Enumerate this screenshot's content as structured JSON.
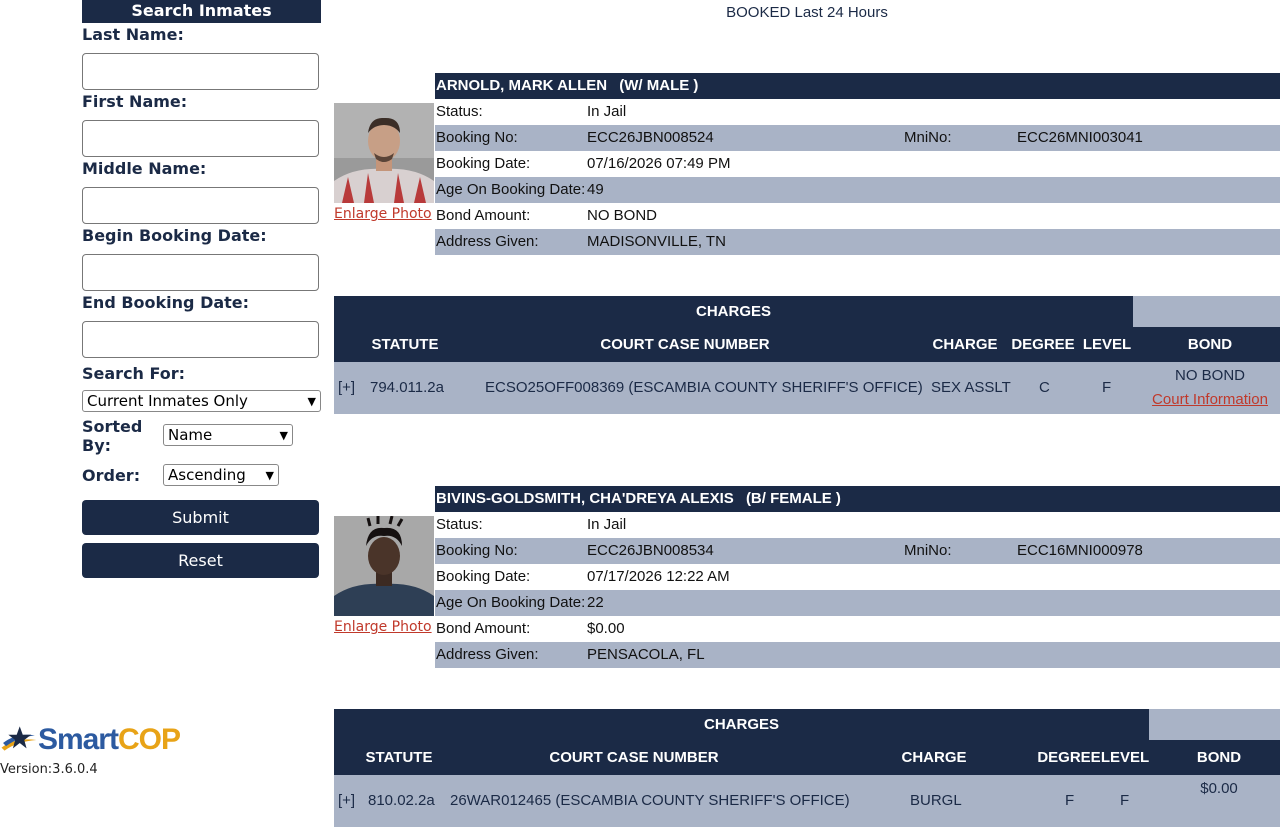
{
  "search": {
    "title": "Search Inmates",
    "fields": [
      {
        "label": "Last Name:",
        "value": ""
      },
      {
        "label": "First Name:",
        "value": ""
      },
      {
        "label": "Middle Name:",
        "value": ""
      },
      {
        "label": "Begin Booking Date:",
        "value": ""
      },
      {
        "label": "End Booking Date:",
        "value": ""
      }
    ],
    "search_for_label": "Search For:",
    "search_for_value": "Current Inmates Only",
    "sorted_by_label": "Sorted By:",
    "sorted_by_value": "Name",
    "order_label": "Order:",
    "order_value": "Ascending",
    "submit_label": "Submit",
    "reset_label": "Reset"
  },
  "logo": {
    "brand_smart": "Smart",
    "brand_cop": "COP",
    "version": "Version:3.6.0.4"
  },
  "heading": "BOOKED Last 24 Hours",
  "labels": {
    "status": "Status:",
    "booking_no": "Booking No:",
    "mni_no": "MniNo:",
    "booking_date": "Booking Date:",
    "age": "Age On Booking Date:",
    "bond_amount": "Bond Amount:",
    "address": "Address Given:",
    "enlarge": "Enlarge Photo",
    "charges": "CHARGES",
    "expand": "[+]",
    "court_info": "Court Information",
    "cols": {
      "statute": "STATUTE",
      "case": "COURT CASE NUMBER",
      "charge": "CHARGE",
      "degree": "DEGREE",
      "level": "LEVEL",
      "bond": "BOND"
    }
  },
  "inmates": [
    {
      "name": "ARNOLD, MARK ALLEN",
      "race_sex": "(W/ MALE )",
      "status": "In Jail",
      "booking_no": "ECC26JBN008524",
      "mni_no": "ECC26MNI003041",
      "booking_date": "07/16/2026 07:49 PM",
      "age": "49",
      "bond_amount": "NO BOND",
      "address": "MADISONVILLE, TN",
      "charge": {
        "statute": "794.011.2a",
        "case_number": "ECSO25OFF008369 (ESCAMBIA COUNTY SHERIFF'S OFFICE)",
        "charge": "SEX ASSLT",
        "degree": "C",
        "level": "F",
        "bond": "NO BOND"
      }
    },
    {
      "name": "BIVINS-GOLDSMITH, CHA'DREYA ALEXIS",
      "race_sex": "(B/ FEMALE )",
      "status": "In Jail",
      "booking_no": "ECC26JBN008534",
      "mni_no": "ECC16MNI000978",
      "booking_date": "07/17/2026 12:22 AM",
      "age": "22",
      "bond_amount": "$0.00",
      "address": "PENSACOLA, FL",
      "charge": {
        "statute": "810.02.2a",
        "case_number": "26WAR012465 (ESCAMBIA COUNTY SHERIFF'S OFFICE)",
        "charge": "BURGL",
        "degree": "F",
        "level": "F",
        "bond": "$0.00"
      }
    }
  ]
}
